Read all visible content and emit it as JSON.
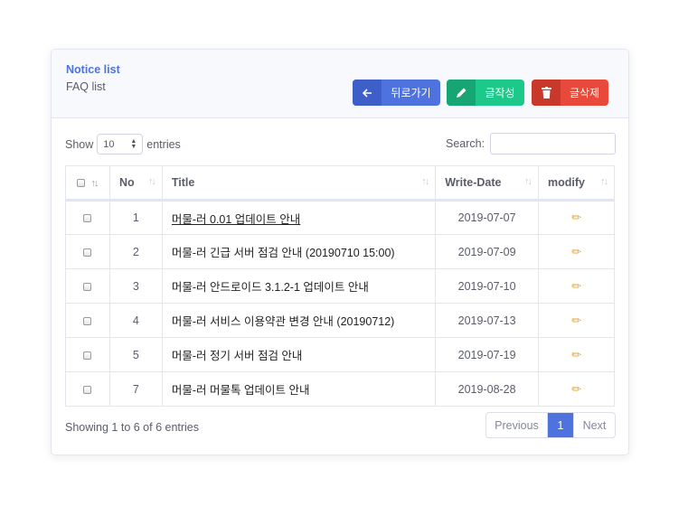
{
  "header": {
    "title": "Notice list",
    "subtitle": "FAQ list",
    "buttons": {
      "back": "뒤로가기",
      "write": "글작성",
      "delete": "글삭제"
    }
  },
  "controls": {
    "show_label": "Show",
    "page_size": "10",
    "entries_label": "entries",
    "search_label": "Search:"
  },
  "table": {
    "columns": [
      "No",
      "Title",
      "Write-Date",
      "modify"
    ],
    "rows": [
      {
        "no": "1",
        "title": "머물-러 0.01 업데이트 안내",
        "date": "2019-07-07"
      },
      {
        "no": "2",
        "title": "머물-러 긴급 서버 점검 안내 (20190710 15:00)",
        "date": "2019-07-09"
      },
      {
        "no": "3",
        "title": "머물-러 안드로이드 3.1.2-1 업데이트 안내",
        "date": "2019-07-10"
      },
      {
        "no": "4",
        "title": "머물-러 서비스 이용약관 변경 안내 (20190712)",
        "date": "2019-07-13"
      },
      {
        "no": "5",
        "title": "머물-러 정기 서버 점검 안내",
        "date": "2019-07-19"
      },
      {
        "no": "7",
        "title": "머물-러 머물톡 업데이트 안내",
        "date": "2019-08-28"
      }
    ]
  },
  "footer": {
    "info": "Showing 1 to 6 of 6 entries",
    "pagination": {
      "previous": "Previous",
      "current": "1",
      "next": "Next"
    }
  },
  "colors": {
    "primary": "#4e73df",
    "success": "#1cc88a",
    "danger": "#e74a3b"
  },
  "icons": {
    "back": "arrow-left-icon",
    "write": "pencil-icon",
    "delete": "trash-icon",
    "modify": "pencil-icon"
  }
}
